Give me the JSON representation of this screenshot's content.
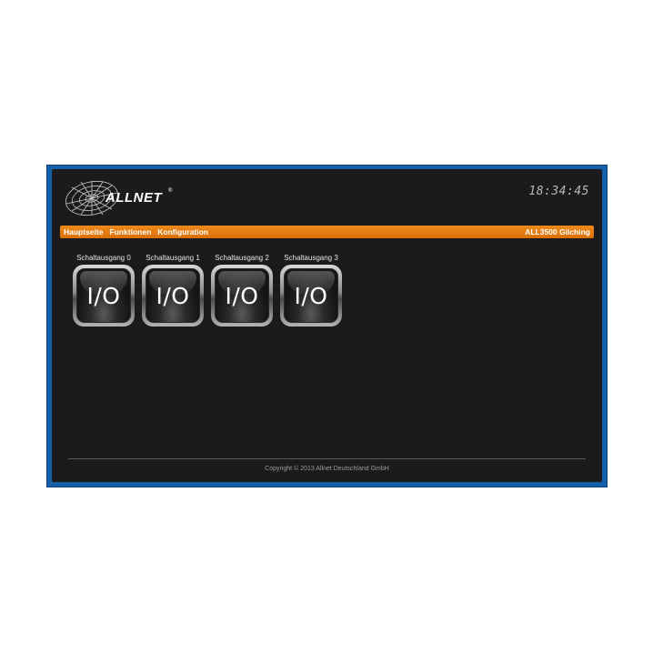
{
  "header": {
    "logo_text": "ALLNET",
    "logo_mark": "®",
    "clock": "18:34:45"
  },
  "nav": {
    "items": [
      {
        "label": "Hauptseite"
      },
      {
        "label": "Funktionen"
      },
      {
        "label": "Konfiguration"
      }
    ],
    "device_name": "ALL3500 Gilching"
  },
  "outputs": [
    {
      "label": "Schaltausgang 0",
      "button_text": "I/O"
    },
    {
      "label": "Schaltausgang 1",
      "button_text": "I/O"
    },
    {
      "label": "Schaltausgang 2",
      "button_text": "I/O"
    },
    {
      "label": "Schaltausgang 3",
      "button_text": "I/O"
    }
  ],
  "footer": {
    "copyright": "Copyright © 2013 Allnet Deutschland GmbH"
  },
  "colors": {
    "frame": "#1560a8",
    "panel": "#1c1a1c",
    "navbar": "#e87c10",
    "text": "#ffffff"
  },
  "icons": {
    "logo": "globe-grid-icon"
  }
}
